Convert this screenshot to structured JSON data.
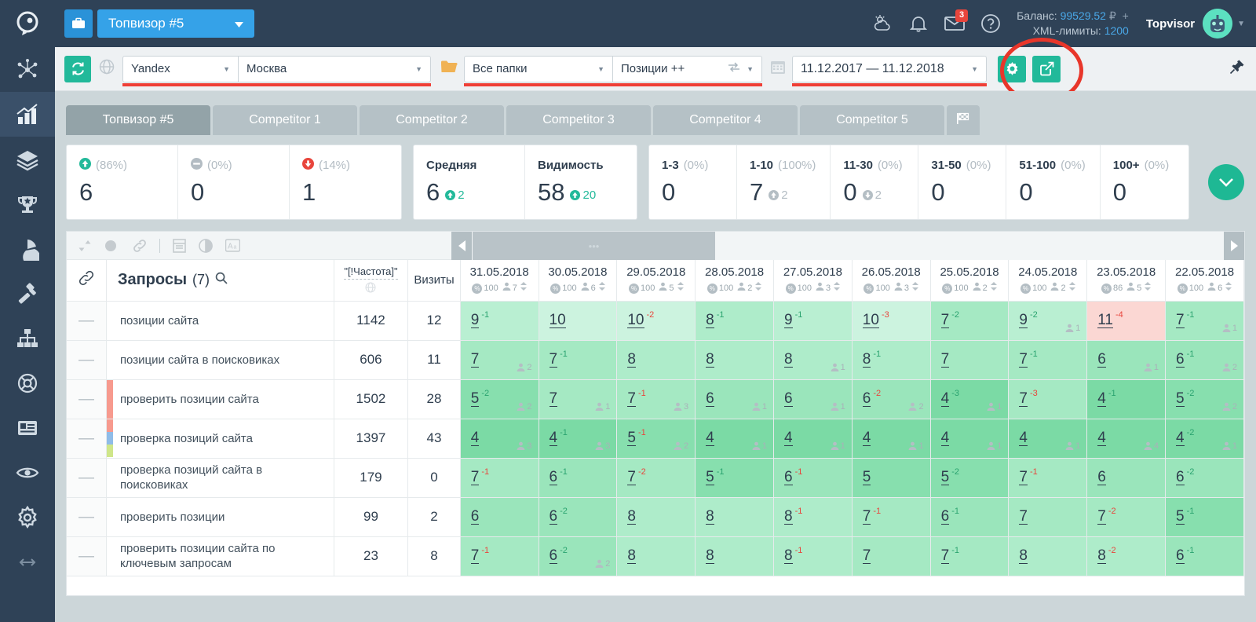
{
  "topbar": {
    "briefcase_icon": "briefcase-icon",
    "project_label": "Топвизор #5",
    "weather_icon": "weather-icon",
    "bell_icon": "bell-icon",
    "mail_icon": "mail-icon",
    "mail_badge": "3",
    "help_icon": "help-icon",
    "balance_label": "Баланс:",
    "balance_value": "99529.52",
    "balance_currency": "₽",
    "balance_plus": "+",
    "xml_label": "XML-лимиты:",
    "xml_value": "1200",
    "username": "Topvisor"
  },
  "rail": {
    "items": [
      {
        "name": "sidebar-item-clusters",
        "icon": "network-icon",
        "active": false
      },
      {
        "name": "sidebar-item-positions",
        "icon": "bar-chart-icon",
        "active": true
      },
      {
        "name": "sidebar-item-layers",
        "icon": "layers-icon",
        "active": false
      },
      {
        "name": "sidebar-item-ranking",
        "icon": "trophy-icon",
        "active": false
      },
      {
        "name": "sidebar-item-analytics",
        "icon": "pie-chart-icon",
        "active": false
      },
      {
        "name": "sidebar-item-tools",
        "icon": "hammer-icon",
        "active": false
      },
      {
        "name": "sidebar-item-structure",
        "icon": "sitemap-icon",
        "active": false
      },
      {
        "name": "sidebar-item-support",
        "icon": "lifebuoy-icon",
        "active": false
      },
      {
        "name": "sidebar-item-reports",
        "icon": "document-icon",
        "active": false
      },
      {
        "name": "sidebar-item-visibility",
        "icon": "eye-icon",
        "active": false
      },
      {
        "name": "sidebar-item-settings",
        "icon": "gear-icon",
        "active": false
      },
      {
        "name": "sidebar-item-collapse",
        "icon": "arrows-horizontal-icon",
        "active": false
      }
    ]
  },
  "filterbar": {
    "refresh_icon": "refresh-icon",
    "globe_icon": "globe-icon",
    "search_engine": "Yandex",
    "region": "Москва",
    "folder_icon": "folder-icon",
    "folder": "Все папки",
    "preset": "Позиции ++",
    "preset_swap_icon": "swap-icon",
    "calendar_icon": "calendar-icon",
    "date_range": "11.12.2017 — 11.12.2018",
    "gear_icon": "gear-icon",
    "export_icon": "export-icon",
    "pin_icon": "pin-icon",
    "accent_green": "#22b99a",
    "highlight_red": "#e8362a"
  },
  "tabs": [
    {
      "label": "Топвизор #5",
      "active": true
    },
    {
      "label": "Competitor 1",
      "active": false
    },
    {
      "label": "Competitor 2",
      "active": false
    },
    {
      "label": "Competitor 3",
      "active": false
    },
    {
      "label": "Competitor 4",
      "active": false
    },
    {
      "label": "Competitor 5",
      "active": false
    }
  ],
  "tab_flag_icon": "flag-icon",
  "stats": {
    "group1": [
      {
        "icon": "arrow-up-circle-icon",
        "icon_color": "#22b99a",
        "pct": "(86%)",
        "value": "6"
      },
      {
        "icon": "minus-circle-icon",
        "icon_color": "#b3bcc3",
        "pct": "(0%)",
        "value": "0"
      },
      {
        "icon": "arrow-down-circle-icon",
        "icon_color": "#e8453c",
        "pct": "(14%)",
        "value": "1"
      }
    ],
    "group2": [
      {
        "label": "Средняя",
        "value": "6",
        "delta_icon": "arrow-up-circle-icon",
        "delta": "2",
        "delta_color": "#22b99a"
      },
      {
        "label": "Видимость",
        "value": "58",
        "delta_icon": "arrow-up-circle-icon",
        "delta": "20",
        "delta_color": "#22b99a"
      }
    ],
    "group3": [
      {
        "label": "1-3",
        "pct": "(0%)",
        "value": "0",
        "delta_icon": "",
        "delta": ""
      },
      {
        "label": "1-10",
        "pct": "(100%)",
        "value": "7",
        "delta_icon": "arrow-up-circle-icon",
        "delta": "2"
      },
      {
        "label": "11-30",
        "pct": "(0%)",
        "value": "0",
        "delta_icon": "arrow-down-circle-icon",
        "delta": "2"
      },
      {
        "label": "31-50",
        "pct": "(0%)",
        "value": "0",
        "delta_icon": "",
        "delta": ""
      },
      {
        "label": "51-100",
        "pct": "(0%)",
        "value": "0",
        "delta_icon": "",
        "delta": ""
      },
      {
        "label": "100+",
        "pct": "(0%)",
        "value": "0",
        "delta_icon": "",
        "delta": ""
      }
    ],
    "expand_icon": "chevron-down-icon"
  },
  "table_toolbar": {
    "icons": [
      "sort-icon",
      "color-icon",
      "link-icon",
      "columns-icon",
      "contrast-icon",
      "text-case-icon"
    ],
    "scroll_left_icon": "chevron-left-icon",
    "scroll_right_icon": "chevron-right-icon",
    "scroll_thumb_dots": "•••"
  },
  "table": {
    "link_icon": "link-icon",
    "title": "Запросы",
    "count": "(7)",
    "search_icon": "search-icon",
    "freq_header": "\"[!Частота]\"",
    "freq_sub_icon": "globe-icon",
    "visits_header": "Визиты",
    "date_columns": [
      {
        "date": "31.05.2018",
        "pct": "100",
        "users": "7"
      },
      {
        "date": "30.05.2018",
        "pct": "100",
        "users": "6"
      },
      {
        "date": "29.05.2018",
        "pct": "100",
        "users": "5"
      },
      {
        "date": "28.05.2018",
        "pct": "100",
        "users": "2"
      },
      {
        "date": "27.05.2018",
        "pct": "100",
        "users": "3"
      },
      {
        "date": "26.05.2018",
        "pct": "100",
        "users": "3"
      },
      {
        "date": "25.05.2018",
        "pct": "100",
        "users": "2"
      },
      {
        "date": "24.05.2018",
        "pct": "100",
        "users": "2"
      },
      {
        "date": "23.05.2018",
        "pct": "86",
        "users": "5"
      },
      {
        "date": "22.05.2018",
        "pct": "100",
        "users": "6"
      }
    ],
    "handle_glyph": "—",
    "rows": [
      {
        "query": "позиции сайта",
        "freq": "1142",
        "visits": "12",
        "tags": [],
        "cells": [
          {
            "v": "9",
            "d": "-1",
            "dir": "up",
            "bg": "#b9efd2",
            "u": ""
          },
          {
            "v": "10",
            "d": "",
            "dir": "",
            "bg": "#ccf3df",
            "u": ""
          },
          {
            "v": "10",
            "d": "-2",
            "dir": "down",
            "bg": "#ccf3df",
            "u": ""
          },
          {
            "v": "8",
            "d": "-1",
            "dir": "up",
            "bg": "#aeecca",
            "u": ""
          },
          {
            "v": "9",
            "d": "-1",
            "dir": "up",
            "bg": "#b9efd2",
            "u": ""
          },
          {
            "v": "10",
            "d": "-3",
            "dir": "down",
            "bg": "#ccf3df",
            "u": ""
          },
          {
            "v": "7",
            "d": "-2",
            "dir": "up",
            "bg": "#a5e9c3",
            "u": ""
          },
          {
            "v": "9",
            "d": "-2",
            "dir": "up",
            "bg": "#b9efd2",
            "u": "1"
          },
          {
            "v": "11",
            "d": "-4",
            "dir": "down",
            "bg": "#fbd7d3",
            "u": ""
          },
          {
            "v": "7",
            "d": "-1",
            "dir": "up",
            "bg": "#a5e9c3",
            "u": "1"
          }
        ]
      },
      {
        "query": "позиции сайта в поисковиках",
        "freq": "606",
        "visits": "11",
        "tags": [],
        "cells": [
          {
            "v": "7",
            "d": "",
            "dir": "",
            "bg": "#a5e9c3",
            "u": "2"
          },
          {
            "v": "7",
            "d": "-1",
            "dir": "up",
            "bg": "#a5e9c3",
            "u": ""
          },
          {
            "v": "8",
            "d": "",
            "dir": "",
            "bg": "#aeecca",
            "u": ""
          },
          {
            "v": "8",
            "d": "",
            "dir": "",
            "bg": "#aeecca",
            "u": ""
          },
          {
            "v": "8",
            "d": "",
            "dir": "",
            "bg": "#aeecca",
            "u": "1"
          },
          {
            "v": "8",
            "d": "-1",
            "dir": "up",
            "bg": "#aeecca",
            "u": ""
          },
          {
            "v": "7",
            "d": "",
            "dir": "",
            "bg": "#a5e9c3",
            "u": ""
          },
          {
            "v": "7",
            "d": "-1",
            "dir": "up",
            "bg": "#a5e9c3",
            "u": ""
          },
          {
            "v": "6",
            "d": "",
            "dir": "",
            "bg": "#9ae5bb",
            "u": "1"
          },
          {
            "v": "6",
            "d": "-1",
            "dir": "up",
            "bg": "#9ae5bb",
            "u": "2"
          }
        ]
      },
      {
        "query": "проверить позиции сайта",
        "freq": "1502",
        "visits": "28",
        "tags": [
          "#f79a8e"
        ],
        "cells": [
          {
            "v": "5",
            "d": "-2",
            "dir": "up",
            "bg": "#87dfae",
            "u": "2"
          },
          {
            "v": "7",
            "d": "",
            "dir": "",
            "bg": "#a5e9c3",
            "u": "1"
          },
          {
            "v": "7",
            "d": "-1",
            "dir": "down",
            "bg": "#a5e9c3",
            "u": "3"
          },
          {
            "v": "6",
            "d": "",
            "dir": "",
            "bg": "#9ae5bb",
            "u": "1"
          },
          {
            "v": "6",
            "d": "",
            "dir": "",
            "bg": "#9ae5bb",
            "u": "1"
          },
          {
            "v": "6",
            "d": "-2",
            "dir": "down",
            "bg": "#9ae5bb",
            "u": "2"
          },
          {
            "v": "4",
            "d": "-3",
            "dir": "up",
            "bg": "#7bdaa5",
            "u": "1"
          },
          {
            "v": "7",
            "d": "-3",
            "dir": "down",
            "bg": "#a5e9c3",
            "u": ""
          },
          {
            "v": "4",
            "d": "-1",
            "dir": "up",
            "bg": "#7bdaa5",
            "u": ""
          },
          {
            "v": "5",
            "d": "-2",
            "dir": "up",
            "bg": "#87dfae",
            "u": "2"
          }
        ]
      },
      {
        "query": "проверка позиций сайта",
        "freq": "1397",
        "visits": "43",
        "tags": [
          "#f79a8e",
          "#8fbce8",
          "#cfe68a"
        ],
        "cells": [
          {
            "v": "4",
            "d": "",
            "dir": "",
            "bg": "#7bdaa5",
            "u": "3"
          },
          {
            "v": "4",
            "d": "-1",
            "dir": "up",
            "bg": "#7bdaa5",
            "u": "3"
          },
          {
            "v": "5",
            "d": "-1",
            "dir": "down",
            "bg": "#87dfae",
            "u": "2"
          },
          {
            "v": "4",
            "d": "",
            "dir": "",
            "bg": "#7bdaa5",
            "u": "1"
          },
          {
            "v": "4",
            "d": "",
            "dir": "",
            "bg": "#7bdaa5",
            "u": "1"
          },
          {
            "v": "4",
            "d": "",
            "dir": "",
            "bg": "#7bdaa5",
            "u": "1"
          },
          {
            "v": "4",
            "d": "",
            "dir": "",
            "bg": "#7bdaa5",
            "u": "1"
          },
          {
            "v": "4",
            "d": "",
            "dir": "",
            "bg": "#7bdaa5",
            "u": "1"
          },
          {
            "v": "4",
            "d": "",
            "dir": "",
            "bg": "#7bdaa5",
            "u": "4"
          },
          {
            "v": "4",
            "d": "-2",
            "dir": "up",
            "bg": "#7bdaa5",
            "u": "1"
          }
        ]
      },
      {
        "query": "проверка позиций сайта в поисковиках",
        "freq": "179",
        "visits": "0",
        "tags": [],
        "cells": [
          {
            "v": "7",
            "d": "-1",
            "dir": "down",
            "bg": "#a5e9c3",
            "u": ""
          },
          {
            "v": "6",
            "d": "-1",
            "dir": "up",
            "bg": "#9ae5bb",
            "u": ""
          },
          {
            "v": "7",
            "d": "-2",
            "dir": "down",
            "bg": "#a5e9c3",
            "u": ""
          },
          {
            "v": "5",
            "d": "-1",
            "dir": "up",
            "bg": "#87dfae",
            "u": ""
          },
          {
            "v": "6",
            "d": "-1",
            "dir": "down",
            "bg": "#9ae5bb",
            "u": ""
          },
          {
            "v": "5",
            "d": "",
            "dir": "",
            "bg": "#87dfae",
            "u": ""
          },
          {
            "v": "5",
            "d": "-2",
            "dir": "up",
            "bg": "#87dfae",
            "u": ""
          },
          {
            "v": "7",
            "d": "-1",
            "dir": "down",
            "bg": "#a5e9c3",
            "u": ""
          },
          {
            "v": "6",
            "d": "",
            "dir": "",
            "bg": "#9ae5bb",
            "u": ""
          },
          {
            "v": "6",
            "d": "-2",
            "dir": "up",
            "bg": "#9ae5bb",
            "u": ""
          }
        ]
      },
      {
        "query": "проверить позиции",
        "freq": "99",
        "visits": "2",
        "tags": [],
        "cells": [
          {
            "v": "6",
            "d": "",
            "dir": "",
            "bg": "#9ae5bb",
            "u": ""
          },
          {
            "v": "6",
            "d": "-2",
            "dir": "up",
            "bg": "#9ae5bb",
            "u": ""
          },
          {
            "v": "8",
            "d": "",
            "dir": "",
            "bg": "#aeecca",
            "u": ""
          },
          {
            "v": "8",
            "d": "",
            "dir": "",
            "bg": "#aeecca",
            "u": ""
          },
          {
            "v": "8",
            "d": "-1",
            "dir": "down",
            "bg": "#aeecca",
            "u": ""
          },
          {
            "v": "7",
            "d": "-1",
            "dir": "down",
            "bg": "#a5e9c3",
            "u": ""
          },
          {
            "v": "6",
            "d": "-1",
            "dir": "up",
            "bg": "#9ae5bb",
            "u": ""
          },
          {
            "v": "7",
            "d": "",
            "dir": "",
            "bg": "#a5e9c3",
            "u": ""
          },
          {
            "v": "7",
            "d": "-2",
            "dir": "down",
            "bg": "#a5e9c3",
            "u": ""
          },
          {
            "v": "5",
            "d": "-1",
            "dir": "up",
            "bg": "#87dfae",
            "u": ""
          }
        ]
      },
      {
        "query": "проверить позиции сайта по ключевым запросам",
        "freq": "23",
        "visits": "8",
        "tags": [],
        "cells": [
          {
            "v": "7",
            "d": "-1",
            "dir": "down",
            "bg": "#a5e9c3",
            "u": ""
          },
          {
            "v": "6",
            "d": "-2",
            "dir": "up",
            "bg": "#9ae5bb",
            "u": "2"
          },
          {
            "v": "8",
            "d": "",
            "dir": "",
            "bg": "#aeecca",
            "u": ""
          },
          {
            "v": "8",
            "d": "",
            "dir": "",
            "bg": "#aeecca",
            "u": ""
          },
          {
            "v": "8",
            "d": "-1",
            "dir": "down",
            "bg": "#aeecca",
            "u": ""
          },
          {
            "v": "7",
            "d": "",
            "dir": "",
            "bg": "#a5e9c3",
            "u": ""
          },
          {
            "v": "7",
            "d": "-1",
            "dir": "up",
            "bg": "#a5e9c3",
            "u": ""
          },
          {
            "v": "8",
            "d": "",
            "dir": "",
            "bg": "#aeecca",
            "u": ""
          },
          {
            "v": "8",
            "d": "-2",
            "dir": "down",
            "bg": "#aeecca",
            "u": ""
          },
          {
            "v": "6",
            "d": "-1",
            "dir": "up",
            "bg": "#9ae5bb",
            "u": ""
          }
        ]
      }
    ]
  }
}
